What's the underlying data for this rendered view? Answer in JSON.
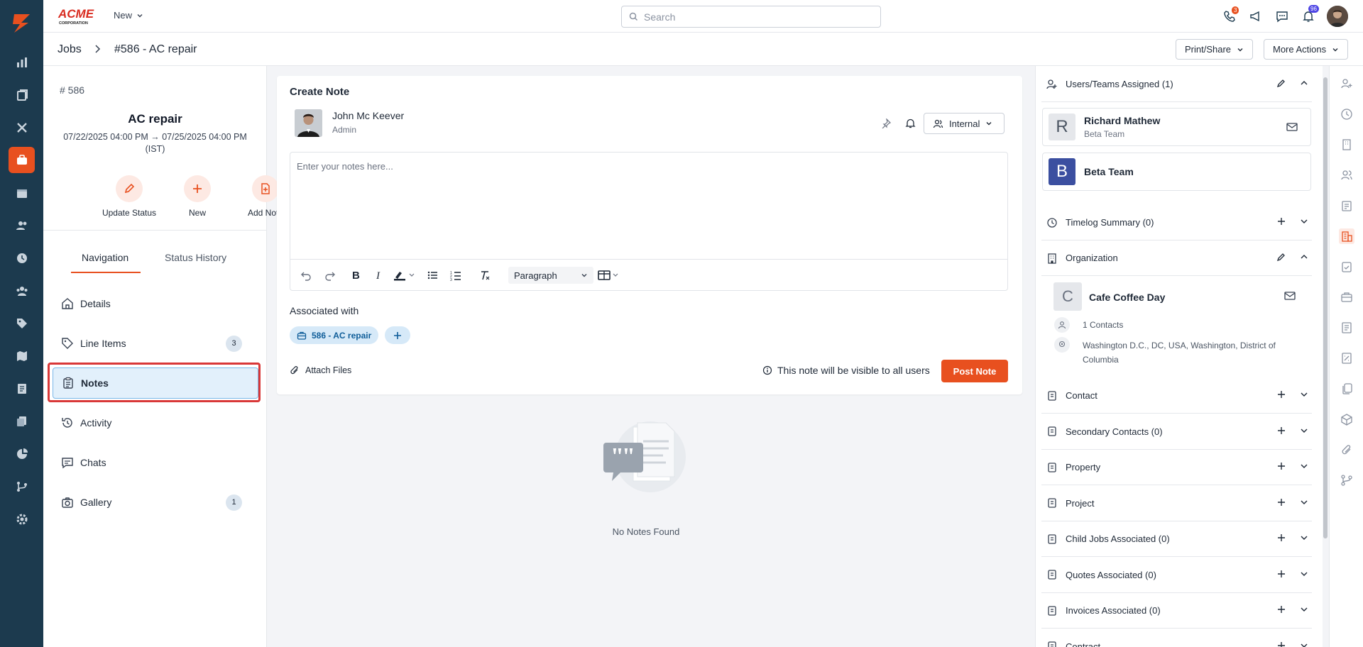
{
  "header": {
    "new_label": "New",
    "search_placeholder": "Search",
    "chat_badge": "3",
    "notif_badge": "96"
  },
  "breadcrumb": {
    "root": "Jobs",
    "current": "#586 - AC repair",
    "print_share": "Print/Share",
    "more_actions": "More Actions"
  },
  "job": {
    "number": "# 586",
    "title": "AC repair",
    "dates": "07/22/2025 04:00 PM → 07/25/2025 04:00 PM (IST)",
    "actions": [
      {
        "label": "Update Status",
        "icon": "pencil-icon"
      },
      {
        "label": "New",
        "icon": "plus-icon"
      },
      {
        "label": "Add Note",
        "icon": "add-document-icon"
      }
    ]
  },
  "tabs": {
    "navigation": "Navigation",
    "status_history": "Status History"
  },
  "nav": [
    {
      "label": "Details",
      "icon": "home-icon",
      "count": ""
    },
    {
      "label": "Line Items",
      "icon": "tag-icon",
      "count": "3"
    },
    {
      "label": "Notes",
      "icon": "clipboard-icon",
      "count": ""
    },
    {
      "label": "Activity",
      "icon": "history-icon",
      "count": ""
    },
    {
      "label": "Chats",
      "icon": "chat-icon",
      "count": ""
    },
    {
      "label": "Gallery",
      "icon": "camera-icon",
      "count": "1"
    }
  ],
  "note": {
    "title": "Create Note",
    "author_name": "John Mc Keever",
    "author_role": "Admin",
    "visibility": "Internal",
    "placeholder": "Enter your notes here...",
    "block_format": "Paragraph",
    "associated_label": "Associated with",
    "associated_chip": "586 - AC repair",
    "attach_label": "Attach Files",
    "visibility_note": "This note will be visible to all users",
    "post_label": "Post Note",
    "empty_text": "No Notes Found"
  },
  "right": {
    "users_title": "Users/Teams Assigned (1)",
    "assignees": [
      {
        "initial": "R",
        "name": "Richard Mathew",
        "sub": "Beta Team"
      },
      {
        "initial": "B",
        "name": "Beta Team",
        "sub": ""
      }
    ],
    "timelog": "Timelog Summary (0)",
    "organization": "Organization",
    "org": {
      "initial": "C",
      "name": "Cafe Coffee Day",
      "contacts": "1 Contacts",
      "address": "Washington D.C., DC, USA, Washington, District of Columbia"
    },
    "sections": [
      "Contact",
      "Secondary Contacts (0)",
      "Property",
      "Project",
      "Child Jobs Associated (0)",
      "Quotes Associated (0)",
      "Invoices Associated (0)",
      "Contract"
    ]
  },
  "colors": {
    "accent": "#e8501f",
    "rail": "#1c3a4e",
    "chip": "#d6e9f8",
    "highlight": "#d93838"
  }
}
